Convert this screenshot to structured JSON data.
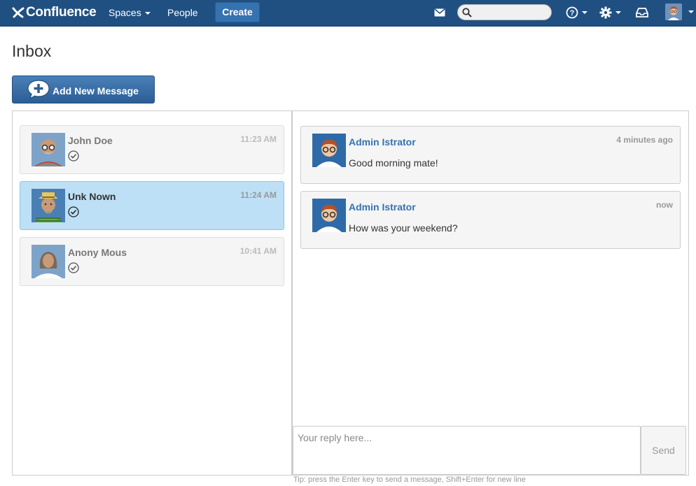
{
  "header": {
    "logo_text": "Confluence",
    "nav": {
      "spaces": "Spaces",
      "people": "People"
    },
    "create_label": "Create",
    "search_placeholder": "",
    "icons": [
      "mail-icon",
      "search-icon",
      "help-icon",
      "gear-icon",
      "inbox-tray-icon",
      "user-avatar"
    ]
  },
  "page": {
    "title": "Inbox",
    "add_button_label": "Add New Message"
  },
  "conversations": [
    {
      "name": "John Doe",
      "time": "11:23 AM",
      "active": false,
      "avatar": "bald-man-glasses"
    },
    {
      "name": "Unk Nown",
      "time": "11:24 AM",
      "active": true,
      "avatar": "man-hat"
    },
    {
      "name": "Anony Mous",
      "time": "10:41 AM",
      "active": false,
      "avatar": "woman-silhouette"
    }
  ],
  "messages": [
    {
      "author": "Admin Istrator",
      "when": "4 minutes ago",
      "text": "Good morning mate!"
    },
    {
      "author": "Admin Istrator",
      "when": "now",
      "text": "How was your weekend?"
    }
  ],
  "reply": {
    "placeholder": "Your reply here...",
    "send_label": "Send",
    "tip": "Tip: press the Enter key to send a message, Shift+Enter for new line"
  },
  "colors": {
    "header_bg": "#205081",
    "create_btn": "#3572b0",
    "active_conversation": "#bde0f6",
    "link": "#3572b0"
  }
}
